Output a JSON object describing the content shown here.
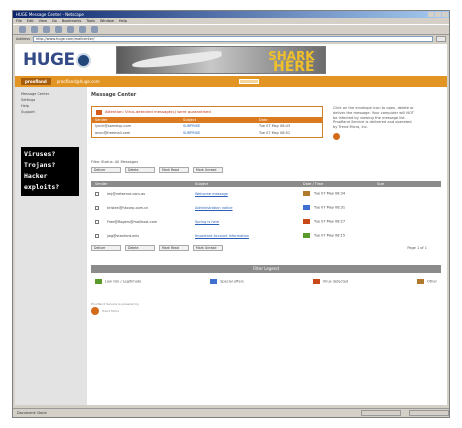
{
  "window": {
    "title": "HUGE Message Center - Netscape"
  },
  "menu": [
    "File",
    "Edit",
    "View",
    "Go",
    "Bookmarks",
    "Tools",
    "Window",
    "Help"
  ],
  "address": {
    "label": "Address",
    "url": "http://www.huge.com/mailcenter/"
  },
  "header": {
    "logo": "HUGE",
    "banner_line1": "SHARK",
    "banner_line2": "HERE"
  },
  "userbar": {
    "user": "proofland",
    "email": "proofland@huge.com"
  },
  "nav": [
    "Message Center",
    "Settings",
    "Help",
    "Support"
  ],
  "virus_text": [
    "Viruses?",
    "Trojans?",
    "Hacker",
    "exploits?"
  ],
  "main": {
    "title": "Message Center",
    "alert": "Attention: Virus-detected message(s) were quarantined",
    "alert_cols": [
      "Sender",
      "Subject",
      "Date"
    ],
    "alert_rows": [
      {
        "sender": "lynch@someisp.com",
        "subject": "SURPRISE",
        "date": "Tue 07 May 08:43"
      },
      {
        "sender": "anon@freemail.com",
        "subject": "SURPRISE",
        "date": "Tue 07 May 08:51"
      }
    ],
    "sidenote": "Click on the envelope icon to open, delete or deliver the message. Your computer will NOT be infected by viewing the message list. Proofland Service is delivered and operated by Trend Micro, Inc.",
    "filter_label": "Filter Status: All Messages",
    "actions": [
      "Deliver",
      "Delete",
      "Mark Read",
      "Mark Unread"
    ],
    "pager": "Page 1 of 1",
    "msg_cols": [
      "Sender",
      "Subject",
      "Date / Time",
      "Size"
    ],
    "messages": [
      {
        "sender": "lmj@netserve.com.au",
        "subject": "Welcome message",
        "date": "Tue 07 May 08:34",
        "color": "#b07a2a"
      },
      {
        "sender": "kristen@hkcorp.com.cn",
        "subject": "Administration notice",
        "date": "Tue 07 May 08:31",
        "color": "#3f6fd0"
      },
      {
        "sender": "Free@Rogers@mailhost.com",
        "subject": "Spring is here",
        "date": "Tue 07 May 08:27",
        "color": "#c84818"
      },
      {
        "sender": "jwg@stanford.edu",
        "subject": "Important Account Information",
        "date": "Tue 07 May 08:15",
        "color": "#5a9a2a"
      }
    ],
    "legend_title": "Filter Legend",
    "legend": [
      {
        "label": "Low risk / Legitimate",
        "color": "#5a9a2a"
      },
      {
        "label": "Special offers",
        "color": "#3f6fd0"
      },
      {
        "label": "Virus detected",
        "color": "#c84818"
      },
      {
        "label": "Other",
        "color": "#b07a2a"
      }
    ],
    "footer_line1": "Proofland Service is powered by",
    "footer_brand": "Trend Micro"
  },
  "statusbar": {
    "text": "Document: Done"
  }
}
